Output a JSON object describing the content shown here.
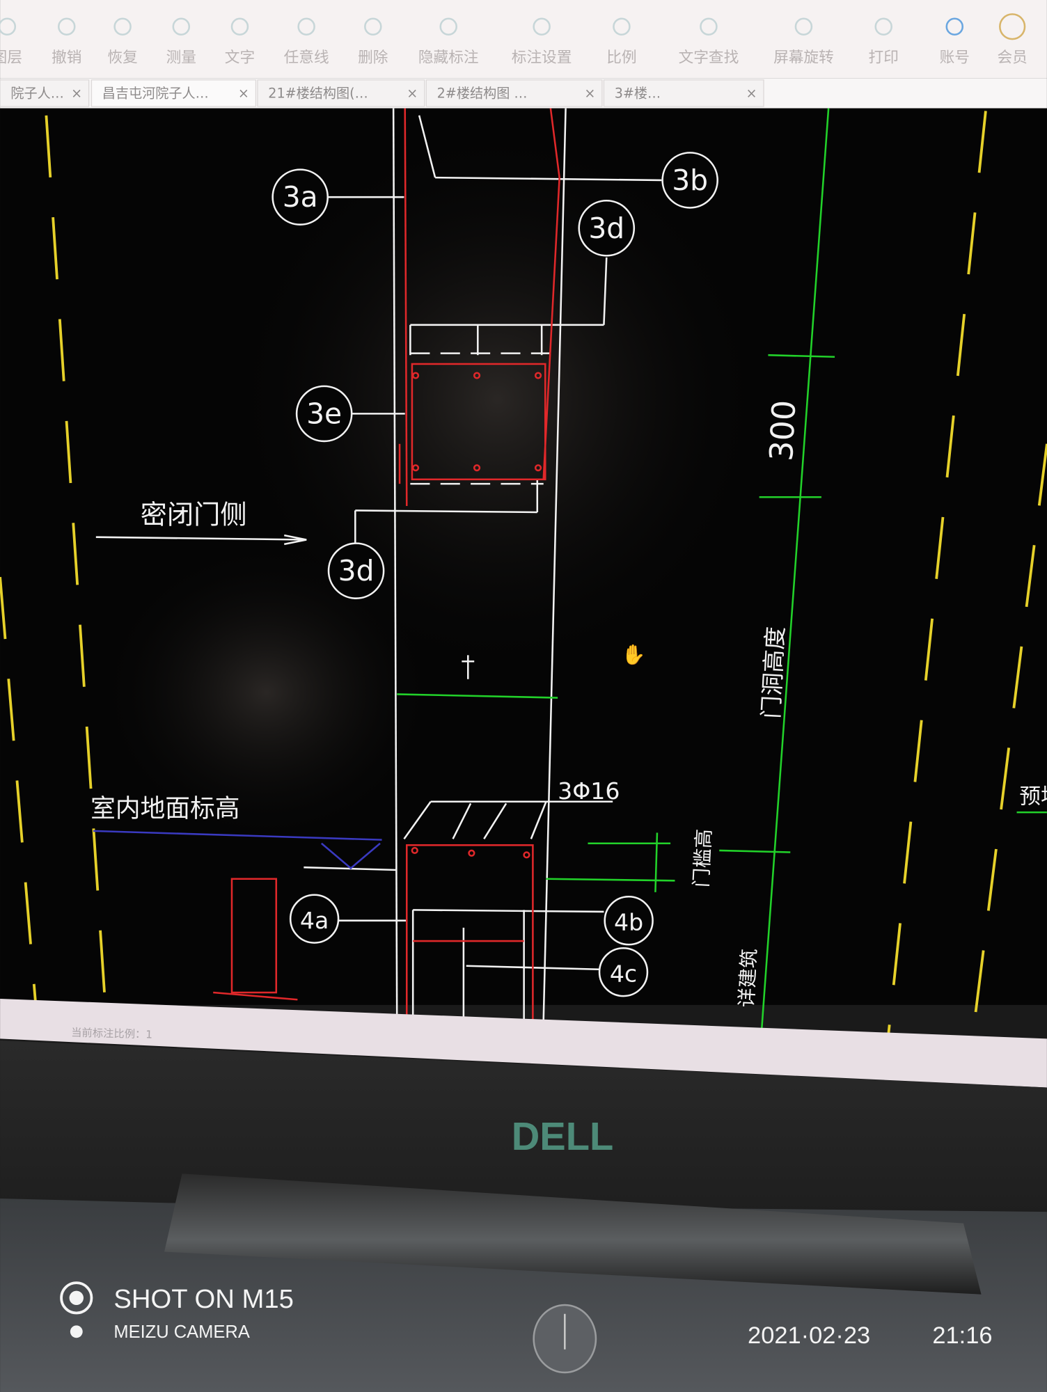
{
  "toolbar": {
    "items": [
      {
        "label": "图层",
        "icon": "layers-icon"
      },
      {
        "label": "撤销",
        "icon": "undo-icon"
      },
      {
        "label": "恢复",
        "icon": "redo-icon"
      },
      {
        "label": "测量",
        "icon": "measure-icon"
      },
      {
        "label": "文字",
        "icon": "text-icon"
      },
      {
        "label": "任意线",
        "icon": "freeline-icon"
      },
      {
        "label": "删除",
        "icon": "delete-icon"
      },
      {
        "label": "隐藏标注",
        "icon": "hide-annotation-icon"
      },
      {
        "label": "标注设置",
        "icon": "annotation-settings-icon"
      },
      {
        "label": "比例",
        "icon": "scale-icon"
      },
      {
        "label": "文字查找",
        "icon": "text-search-icon"
      },
      {
        "label": "屏幕旋转",
        "icon": "rotate-screen-icon"
      },
      {
        "label": "打印",
        "icon": "print-icon"
      },
      {
        "label": "账号",
        "icon": "account-icon"
      },
      {
        "label": "会员",
        "icon": "vip-icon"
      }
    ]
  },
  "tabs": [
    {
      "label": "院子人…",
      "close": "×"
    },
    {
      "label": "昌吉屯河院子人…",
      "close": "×"
    },
    {
      "label": "21#楼结构图(…",
      "close": "×"
    },
    {
      "label": "2#楼结构图 …",
      "close": "×"
    },
    {
      "label": "3#楼…",
      "close": "×"
    }
  ],
  "drawing": {
    "callouts": [
      "3a",
      "3b",
      "3d",
      "3e",
      "3d",
      "4a",
      "4b",
      "4c"
    ],
    "labels": {
      "door_side": "密闭门侧",
      "floor_elevation": "室内地面标高",
      "rebar": "3Φ16",
      "dim_300": "300",
      "door_height": "门洞高度",
      "sill_height": "门槛高",
      "see_arch": "详建筑",
      "embed_partial": "预埋"
    },
    "colors": {
      "background": "#050505",
      "lines": "#f2f2f2",
      "rebar": "#e0282a",
      "dimension": "#22d22a",
      "axis": "#e6d12a",
      "elevation": "#3a3ac0"
    }
  },
  "status": {
    "scale_text": "当前标注比例：1"
  },
  "device": {
    "logo": "DELL"
  },
  "watermark": {
    "line1": "SHOT ON M15",
    "line2": "MEIZU CAMERA",
    "date": "2021·02·23",
    "time": "21:16"
  }
}
